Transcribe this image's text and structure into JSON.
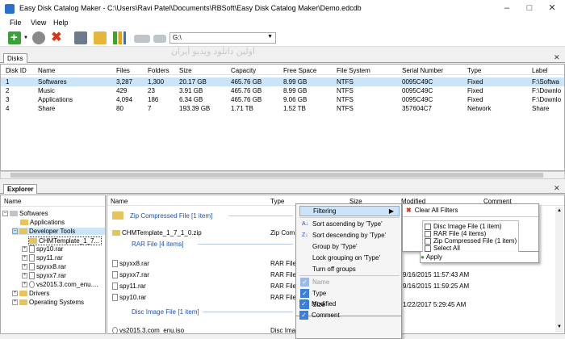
{
  "window": {
    "title": "Easy Disk Catalog Maker - C:\\Users\\Ravi Patel\\Documents\\RBSoft\\Easy Disk Catalog Maker\\Demo.edcdb"
  },
  "menu": {
    "file": "File",
    "view": "View",
    "help": "Help"
  },
  "toolbar": {
    "drive_value": "G:\\"
  },
  "watermark": "اولین دانلود ویدیو ایران",
  "disks": {
    "tab_label": "Disks",
    "columns": [
      "Disk ID",
      "Name",
      "Files",
      "Folders",
      "Size",
      "Capacity",
      "Free Space",
      "File System",
      "Serial Number",
      "Type",
      "Label"
    ],
    "rows": [
      [
        "1",
        "Softwares",
        "3,287",
        "1,300",
        "20.17 GB",
        "465.76 GB",
        "8.99 GB",
        "NTFS",
        "0095C49C",
        "Fixed",
        "F:\\Softwa"
      ],
      [
        "2",
        "Music",
        "429",
        "23",
        "3.91 GB",
        "465.76 GB",
        "8.99 GB",
        "NTFS",
        "0095C49C",
        "Fixed",
        "F:\\Downlo"
      ],
      [
        "3",
        "Applications",
        "4,094",
        "186",
        "6.34 GB",
        "465.76 GB",
        "9.06 GB",
        "NTFS",
        "0095C49C",
        "Fixed",
        "F:\\Downlo"
      ],
      [
        "4",
        "Share",
        "80",
        "7",
        "193.39 GB",
        "1.71 TB",
        "1.52 TB",
        "NTFS",
        "357604C7",
        "Network",
        "Share"
      ]
    ]
  },
  "explorer": {
    "tab_label": "Explorer",
    "tree_header": "Name",
    "tree": [
      "Softwares",
      "Applications",
      "Developer Tools",
      "CHMTemplate_1_7...",
      "spy10.rar",
      "spy11.rar",
      "spyxx8.rar",
      "spyxx7.rar",
      "vs2015.3.com_enu....",
      "Drivers",
      "Operating Systems"
    ],
    "list_headers": {
      "name": "Name",
      "type": "Type",
      "size": "Size",
      "modified": "Modified",
      "comment": "Comment"
    },
    "groups": {
      "zip": "Zip Compressed File [1 item]",
      "rar": "RAR File [4 items]",
      "disc": "Disc Image File [1 item]"
    },
    "files": {
      "chm": {
        "name": "CHMTemplate_1_7_1_0.zip",
        "type": "Zip Com"
      },
      "spyxx8": {
        "name": "spyxx8.rar",
        "type": "RAR File"
      },
      "spyxx7": {
        "name": "spyxx7.rar",
        "type": "RAR File"
      },
      "spy11": {
        "name": "spy11.rar",
        "type": "RAR File",
        "modified": "9/16/2015 11:57:43 AM"
      },
      "spy10": {
        "name": "spy10.rar",
        "type": "RAR File",
        "modified": "9/16/2015 11:59:25 AM"
      },
      "vs": {
        "name": "vs2015.3.com_enu.iso",
        "type": "Disc Ima",
        "modified": "1/22/2017 5:29:45 AM"
      }
    }
  },
  "context_menu": {
    "filtering": "Filtering",
    "sort_asc": "Sort ascending by 'Type'",
    "sort_desc": "Sort descending by 'Type'",
    "group_by": "Group by 'Type'",
    "lock_group": "Lock grouping on 'Type'",
    "turn_off_groups": "Turn off groups",
    "col_name": "Name",
    "col_type": "Type",
    "col_size": "Size",
    "col_modified": "Modified",
    "col_comment": "Comment"
  },
  "filter_menu": {
    "clear": "Clear All Filters",
    "opt1": "Disc Image File (1 item)",
    "opt2": "RAR File (4 items)",
    "opt3": "Zip Compressed File (1 item)",
    "select_all": "Select All",
    "apply": "Apply"
  }
}
